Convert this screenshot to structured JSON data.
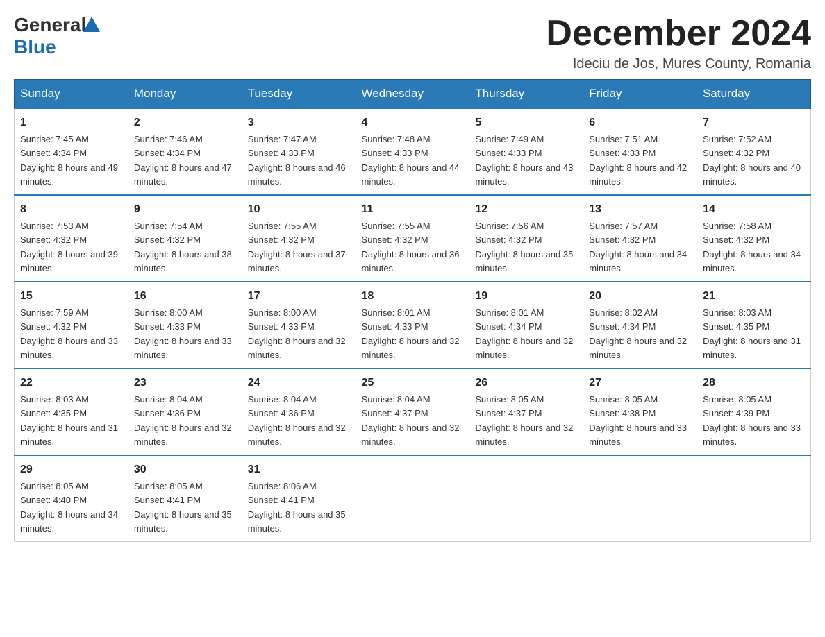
{
  "header": {
    "logo_general": "General",
    "logo_blue": "Blue",
    "month_title": "December 2024",
    "location": "Ideciu de Jos, Mures County, Romania"
  },
  "days_of_week": [
    "Sunday",
    "Monday",
    "Tuesday",
    "Wednesday",
    "Thursday",
    "Friday",
    "Saturday"
  ],
  "weeks": [
    [
      {
        "day": "1",
        "sunrise": "7:45 AM",
        "sunset": "4:34 PM",
        "daylight": "8 hours and 49 minutes."
      },
      {
        "day": "2",
        "sunrise": "7:46 AM",
        "sunset": "4:34 PM",
        "daylight": "8 hours and 47 minutes."
      },
      {
        "day": "3",
        "sunrise": "7:47 AM",
        "sunset": "4:33 PM",
        "daylight": "8 hours and 46 minutes."
      },
      {
        "day": "4",
        "sunrise": "7:48 AM",
        "sunset": "4:33 PM",
        "daylight": "8 hours and 44 minutes."
      },
      {
        "day": "5",
        "sunrise": "7:49 AM",
        "sunset": "4:33 PM",
        "daylight": "8 hours and 43 minutes."
      },
      {
        "day": "6",
        "sunrise": "7:51 AM",
        "sunset": "4:33 PM",
        "daylight": "8 hours and 42 minutes."
      },
      {
        "day": "7",
        "sunrise": "7:52 AM",
        "sunset": "4:32 PM",
        "daylight": "8 hours and 40 minutes."
      }
    ],
    [
      {
        "day": "8",
        "sunrise": "7:53 AM",
        "sunset": "4:32 PM",
        "daylight": "8 hours and 39 minutes."
      },
      {
        "day": "9",
        "sunrise": "7:54 AM",
        "sunset": "4:32 PM",
        "daylight": "8 hours and 38 minutes."
      },
      {
        "day": "10",
        "sunrise": "7:55 AM",
        "sunset": "4:32 PM",
        "daylight": "8 hours and 37 minutes."
      },
      {
        "day": "11",
        "sunrise": "7:55 AM",
        "sunset": "4:32 PM",
        "daylight": "8 hours and 36 minutes."
      },
      {
        "day": "12",
        "sunrise": "7:56 AM",
        "sunset": "4:32 PM",
        "daylight": "8 hours and 35 minutes."
      },
      {
        "day": "13",
        "sunrise": "7:57 AM",
        "sunset": "4:32 PM",
        "daylight": "8 hours and 34 minutes."
      },
      {
        "day": "14",
        "sunrise": "7:58 AM",
        "sunset": "4:32 PM",
        "daylight": "8 hours and 34 minutes."
      }
    ],
    [
      {
        "day": "15",
        "sunrise": "7:59 AM",
        "sunset": "4:32 PM",
        "daylight": "8 hours and 33 minutes."
      },
      {
        "day": "16",
        "sunrise": "8:00 AM",
        "sunset": "4:33 PM",
        "daylight": "8 hours and 33 minutes."
      },
      {
        "day": "17",
        "sunrise": "8:00 AM",
        "sunset": "4:33 PM",
        "daylight": "8 hours and 32 minutes."
      },
      {
        "day": "18",
        "sunrise": "8:01 AM",
        "sunset": "4:33 PM",
        "daylight": "8 hours and 32 minutes."
      },
      {
        "day": "19",
        "sunrise": "8:01 AM",
        "sunset": "4:34 PM",
        "daylight": "8 hours and 32 minutes."
      },
      {
        "day": "20",
        "sunrise": "8:02 AM",
        "sunset": "4:34 PM",
        "daylight": "8 hours and 32 minutes."
      },
      {
        "day": "21",
        "sunrise": "8:03 AM",
        "sunset": "4:35 PM",
        "daylight": "8 hours and 31 minutes."
      }
    ],
    [
      {
        "day": "22",
        "sunrise": "8:03 AM",
        "sunset": "4:35 PM",
        "daylight": "8 hours and 31 minutes."
      },
      {
        "day": "23",
        "sunrise": "8:04 AM",
        "sunset": "4:36 PM",
        "daylight": "8 hours and 32 minutes."
      },
      {
        "day": "24",
        "sunrise": "8:04 AM",
        "sunset": "4:36 PM",
        "daylight": "8 hours and 32 minutes."
      },
      {
        "day": "25",
        "sunrise": "8:04 AM",
        "sunset": "4:37 PM",
        "daylight": "8 hours and 32 minutes."
      },
      {
        "day": "26",
        "sunrise": "8:05 AM",
        "sunset": "4:37 PM",
        "daylight": "8 hours and 32 minutes."
      },
      {
        "day": "27",
        "sunrise": "8:05 AM",
        "sunset": "4:38 PM",
        "daylight": "8 hours and 33 minutes."
      },
      {
        "day": "28",
        "sunrise": "8:05 AM",
        "sunset": "4:39 PM",
        "daylight": "8 hours and 33 minutes."
      }
    ],
    [
      {
        "day": "29",
        "sunrise": "8:05 AM",
        "sunset": "4:40 PM",
        "daylight": "8 hours and 34 minutes."
      },
      {
        "day": "30",
        "sunrise": "8:05 AM",
        "sunset": "4:41 PM",
        "daylight": "8 hours and 35 minutes."
      },
      {
        "day": "31",
        "sunrise": "8:06 AM",
        "sunset": "4:41 PM",
        "daylight": "8 hours and 35 minutes."
      },
      null,
      null,
      null,
      null
    ]
  ],
  "labels": {
    "sunrise": "Sunrise:",
    "sunset": "Sunset:",
    "daylight": "Daylight:"
  }
}
